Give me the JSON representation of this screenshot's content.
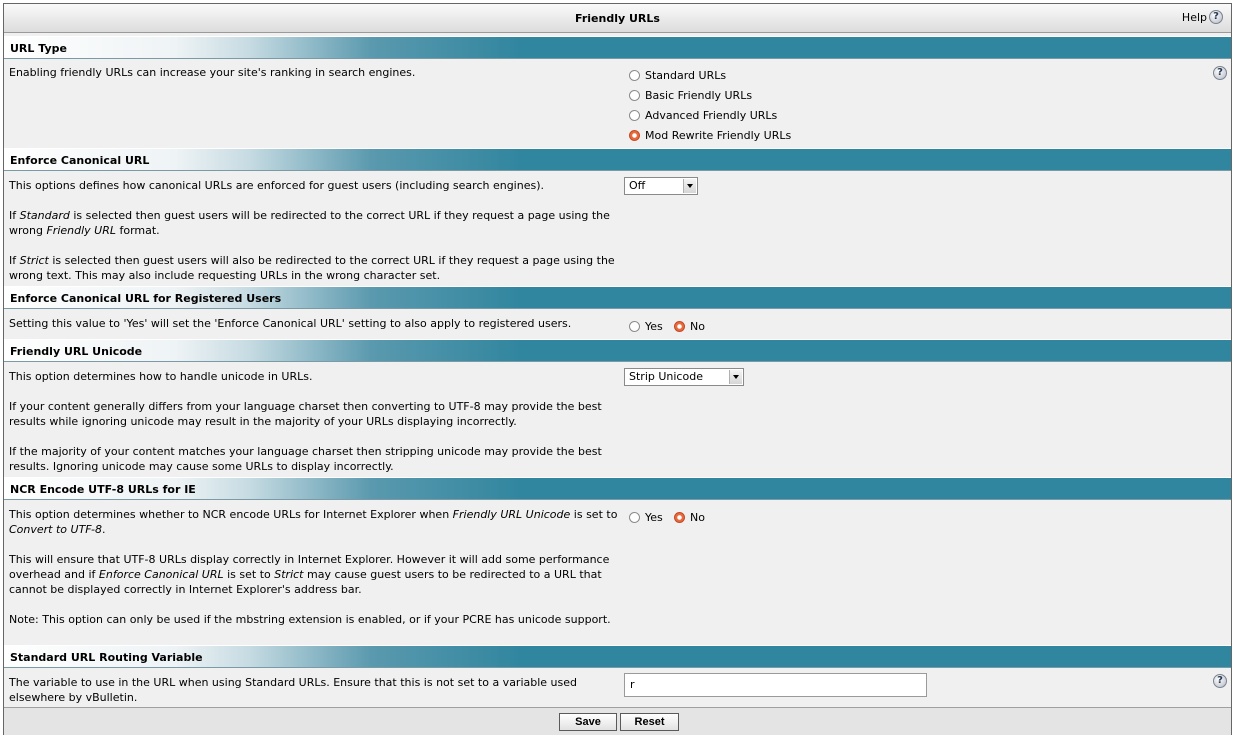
{
  "title": "Friendly URLs",
  "help_label": "Help",
  "help_icon": "question-mark-icon",
  "colors": {
    "header": "#31869f",
    "selected_radio": "#e86a3e",
    "panel_bg": "#f0f0f0"
  },
  "sections": [
    {
      "header": "URL Type",
      "desc": [
        "Enabling friendly URLs can increase your site's ranking in search engines."
      ],
      "options": [
        "Standard URLs",
        "Basic Friendly URLs",
        "Advanced Friendly URLs",
        "Mod Rewrite Friendly URLs"
      ],
      "selected": "Mod Rewrite Friendly URLs"
    },
    {
      "header": "Enforce Canonical URL",
      "desc_intro": "This options defines how canonical URLs are enforced for guest users (including search engines).",
      "desc_p2": {
        "a": "If ",
        "b": "Standard",
        "c": " is selected then guest users will be redirected to the correct URL if they request a page using the wrong ",
        "d": "Friendly URL",
        "e": " format."
      },
      "desc_p3": {
        "a": "If ",
        "b": "Strict",
        "c": " is selected then guest users will also be redirected to the correct URL if they request a page using the wrong text. This may also include requesting URLs in the wrong character set."
      },
      "select_value": "Off"
    },
    {
      "header": "Enforce Canonical URL for Registered Users",
      "desc": "Setting this value to 'Yes' will set the 'Enforce Canonical URL' setting to also apply to registered users.",
      "yes": "Yes",
      "no": "No",
      "selected": "No"
    },
    {
      "header": "Friendly URL Unicode",
      "desc_p1": "This option determines how to handle unicode in URLs.",
      "desc_p2": "If your content generally differs from your language charset then converting to UTF-8 may provide the best results while ignoring unicode may result in the majority of your URLs displaying incorrectly.",
      "desc_p3": "If the majority of your content matches your language charset then stripping unicode may provide the best results. Ignoring unicode may cause some URLs to display incorrectly.",
      "select_value": "Strip Unicode"
    },
    {
      "header": "NCR Encode UTF-8 URLs for IE",
      "desc_p1": {
        "a": "This option determines whether to NCR encode URLs for Internet Explorer when ",
        "b": "Friendly URL Unicode",
        "c": " is set to ",
        "d": "Convert to UTF-8",
        "e": "."
      },
      "desc_p2": {
        "a": "This will ensure that UTF-8 URLs display correctly in Internet Explorer. However it will add some performance overhead and if ",
        "b": "Enforce Canonical URL",
        "c": " is set to ",
        "d": "Strict",
        "e": " may cause guest users to be redirected to a URL that cannot be displayed correctly in Internet Explorer's address bar."
      },
      "desc_p3": "Note: This option can only be used if the mbstring extension is enabled, or if your PCRE has unicode support.",
      "yes": "Yes",
      "no": "No",
      "selected": "No"
    },
    {
      "header": "Standard URL Routing Variable",
      "desc": "The variable to use in the URL when using Standard URLs. Ensure that this is not set to a variable used elsewhere by vBulletin.",
      "input_value": "r"
    }
  ],
  "buttons": {
    "save": "Save",
    "reset": "Reset"
  }
}
